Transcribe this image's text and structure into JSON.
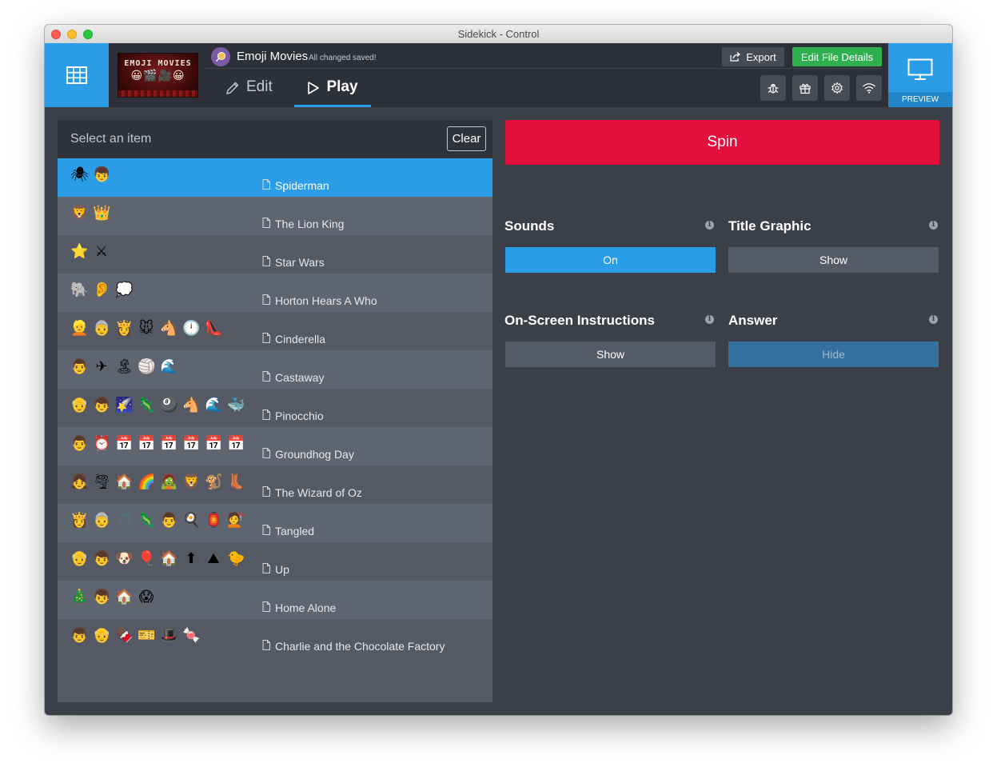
{
  "window": {
    "title": "Sidekick - Control"
  },
  "header": {
    "thumbnail": {
      "line1": "EMOJI MOVIES",
      "line2": "😀🎬🎥😀"
    },
    "file_title": "Emoji Movies",
    "save_status": "All changed saved!",
    "export_label": "Export",
    "edit_details_label": "Edit File Details",
    "tabs": [
      {
        "label": "Edit",
        "icon": "pencil-icon",
        "active": false
      },
      {
        "label": "Play",
        "icon": "play-icon",
        "active": true
      }
    ],
    "tool_icons": [
      "bug-icon",
      "gift-icon",
      "gear-icon",
      "wifi-icon"
    ],
    "preview_label": "PREVIEW"
  },
  "list": {
    "placeholder": "Select an item",
    "clear_label": "Clear",
    "items": [
      {
        "emojis": [
          "🕷",
          "👦"
        ],
        "title": "Spiderman",
        "selected": true
      },
      {
        "emojis": [
          "🦁",
          "👑"
        ],
        "title": "The Lion King"
      },
      {
        "emojis": [
          "⭐",
          "⚔"
        ],
        "title": "Star Wars"
      },
      {
        "emojis": [
          "🐘",
          "👂",
          "💭"
        ],
        "title": "Horton Hears A Who"
      },
      {
        "emojis": [
          "👱",
          "👵",
          "👸",
          "🐭",
          "🐴",
          "🕛",
          "👠"
        ],
        "title": "Cinderella"
      },
      {
        "emojis": [
          "👨",
          "✈",
          "🏝",
          "🏐",
          "🌊"
        ],
        "title": "Castaway"
      },
      {
        "emojis": [
          "👴",
          "👦",
          "🌠",
          "🦎",
          "🎱",
          "🐴",
          "🌊",
          "🐳"
        ],
        "title": "Pinocchio"
      },
      {
        "emojis": [
          "👨",
          "⏰",
          "📅",
          "📅",
          "📅",
          "📅",
          "📅",
          "📅"
        ],
        "title": "Groundhog Day"
      },
      {
        "emojis": [
          "👧",
          "🌪",
          "🏠",
          "🌈",
          "🧟",
          "🦁",
          "🐒",
          "👢"
        ],
        "title": "The Wizard of Oz"
      },
      {
        "emojis": [
          "👸",
          "👵",
          "🎵",
          "🦎",
          "👨",
          "🍳",
          "🏮",
          "💇"
        ],
        "title": "Tangled"
      },
      {
        "emojis": [
          "👴",
          "👦",
          "🐶",
          "🎈",
          "🏠",
          "⬆",
          "⛰",
          "🐤"
        ],
        "title": "Up"
      },
      {
        "emojis": [
          "🎄",
          "👦",
          "🏠",
          "😱"
        ],
        "title": "Home Alone"
      },
      {
        "emojis": [
          "👦",
          "👴",
          "🍫",
          "🎫",
          "🎩",
          "🍬"
        ],
        "title": "Charlie and the Chocolate Factory"
      }
    ]
  },
  "controls": {
    "spin_label": "Spin",
    "sounds": {
      "label": "Sounds",
      "button": "On"
    },
    "title_graphic": {
      "label": "Title Graphic",
      "button": "Show"
    },
    "instructions": {
      "label": "On-Screen Instructions",
      "button": "Show"
    },
    "answer": {
      "label": "Answer",
      "button": "Hide"
    }
  },
  "colors": {
    "accent_blue": "#2a9de6",
    "spin_red": "#e50f3e",
    "green": "#2fb04f",
    "panel_dark": "#3b3f48"
  }
}
